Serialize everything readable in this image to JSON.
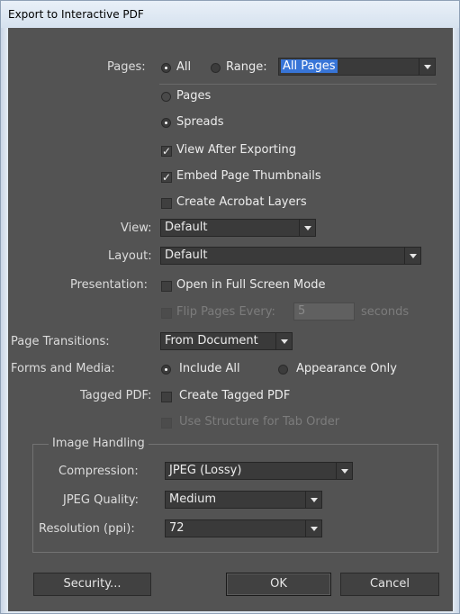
{
  "window": {
    "title": "Export to Interactive PDF"
  },
  "pages": {
    "label": "Pages:",
    "all_label": "All",
    "range_label": "Range:",
    "range_value": "All Pages",
    "pages_option": "Pages",
    "spreads_option": "Spreads",
    "selected_mode": "All",
    "selected_layout": "Spreads"
  },
  "options": {
    "view_after_exporting": {
      "label": "View After Exporting",
      "checked": true
    },
    "embed_page_thumbnails": {
      "label": "Embed Page Thumbnails",
      "checked": true
    },
    "create_acrobat_layers": {
      "label": "Create Acrobat Layers",
      "checked": false
    }
  },
  "view": {
    "label": "View:",
    "value": "Default"
  },
  "layout": {
    "label": "Layout:",
    "value": "Default"
  },
  "presentation": {
    "label": "Presentation:",
    "full_screen_label": "Open in Full Screen Mode",
    "flip_label": "Flip Pages Every:",
    "flip_value": "5",
    "seconds_label": "seconds"
  },
  "page_transitions": {
    "label": "Page Transitions:",
    "value": "From Document"
  },
  "forms_media": {
    "label": "Forms and Media:",
    "include_all": "Include All",
    "appearance_only": "Appearance Only",
    "selected": "Include All"
  },
  "tagged_pdf": {
    "label": "Tagged PDF:",
    "create_label": "Create Tagged PDF",
    "tab_order_label": "Use Structure for Tab Order"
  },
  "image_handling": {
    "title": "Image Handling",
    "compression_label": "Compression:",
    "compression_value": "JPEG (Lossy)",
    "quality_label": "JPEG Quality:",
    "quality_value": "Medium",
    "resolution_label": "Resolution (ppi):",
    "resolution_value": "72"
  },
  "buttons": {
    "security": "Security...",
    "ok": "OK",
    "cancel": "Cancel"
  },
  "colors": {
    "panel": "#535353",
    "field": "#3a3a3a",
    "highlight": "#3875d7"
  }
}
